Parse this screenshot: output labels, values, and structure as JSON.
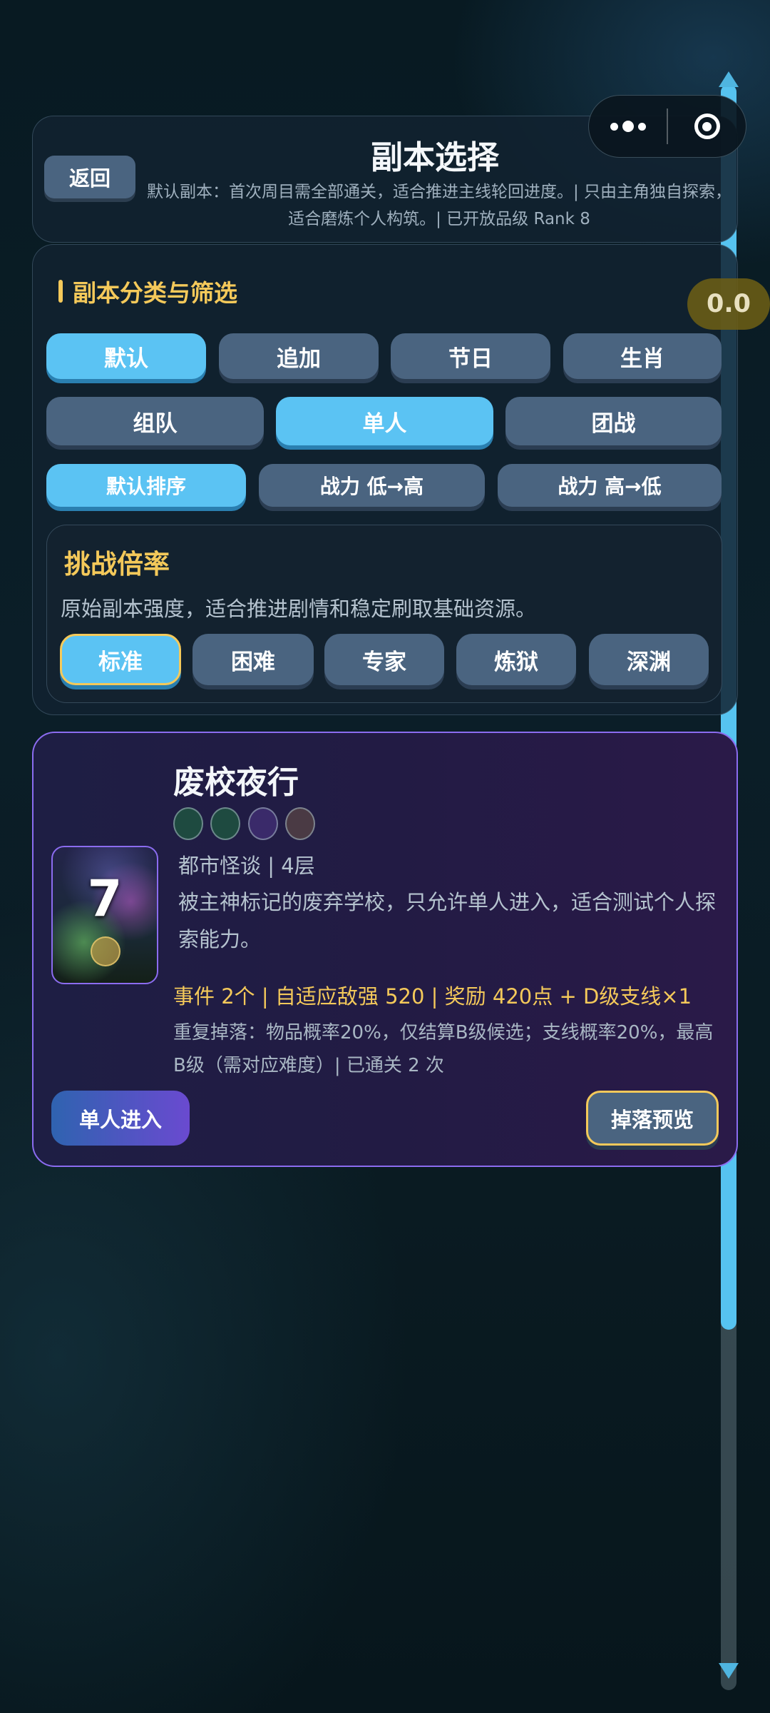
{
  "header": {
    "back_label": "返回",
    "title": "副本选择",
    "subtitle": "默认副本：首次周目需全部通关，适合推进主线轮回进度。| 只由主角独自探索，适合磨炼个人构筑。| 已开放品级 Rank 8"
  },
  "filter": {
    "section_title": "副本分类与筛选",
    "categories": [
      "默认",
      "追加",
      "节日",
      "生肖"
    ],
    "modes": [
      "组队",
      "单人",
      "团战"
    ],
    "sorts": [
      "默认排序",
      "战力 低→高",
      "战力 高→低"
    ],
    "active_category": "默认",
    "active_mode": "单人",
    "active_sort": "默认排序"
  },
  "difficulty": {
    "title": "挑战倍率",
    "desc": "原始副本强度，适合推进剧情和稳定刷取基础资源。",
    "options": [
      "标准",
      "困难",
      "专家",
      "炼狱",
      "深渊"
    ],
    "active": "标准"
  },
  "dungeon": {
    "name": "废校夜行",
    "thumb_number": "7",
    "tag_dot_colors": [
      "#1e4a40",
      "#1e4a40",
      "#3a2a6a",
      "#4a3a44"
    ],
    "meta": "都市怪谈 | 4层",
    "desc": "被主神标记的废弃学校，只允许单人进入，适合测试个人探索能力。",
    "stats": "事件 2个 | 自适应敌强 520 | 奖励 420点 + D级支线×1",
    "drop_info": "重复掉落：物品概率20%，仅结算B级候选；支线概率20%，最高B级（需对应难度）| 已通关 2 次",
    "enter_label": "单人进入",
    "drop_preview_label": "掉落预览"
  },
  "scroll": {
    "badge": "0.0"
  },
  "colors": {
    "accent": "#5bc3f3",
    "gold": "#f4c95a",
    "chip": "#4a6480",
    "card_border": "#8b6cf0"
  }
}
